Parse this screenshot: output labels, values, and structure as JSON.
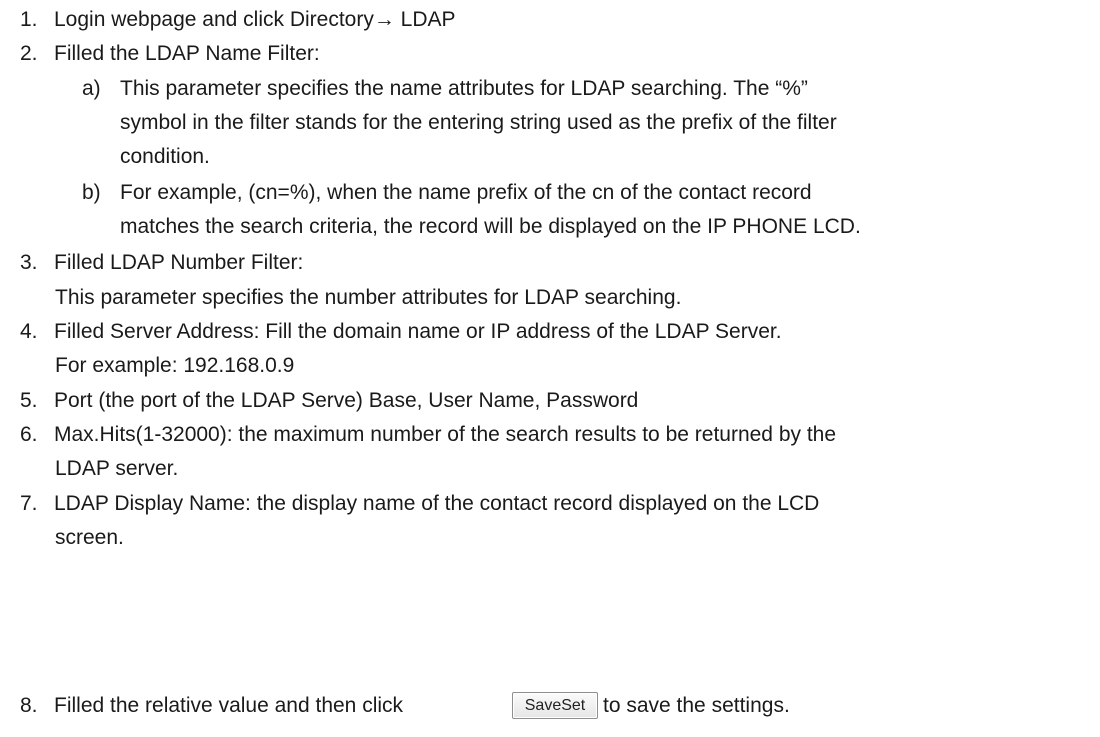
{
  "steps": [
    {
      "num": "1.",
      "text": "Login webpage and click Directory→ LDAP"
    },
    {
      "num": "2.",
      "text": "Filled the LDAP Name Filter:"
    },
    {
      "num": "3.",
      "text": "Filled LDAP Number Filter:"
    },
    {
      "num": "4.",
      "text": "Filled Server Address: Fill the domain name or IP address of the LDAP Server."
    },
    {
      "num": "5.",
      "text": "Port (the port of the LDAP Serve) Base, User Name, Password"
    },
    {
      "num": "6.",
      "text": "Max.Hits(1-32000): the maximum number of the search results to be returned by the"
    },
    {
      "num": "7.",
      "text": "LDAP Display Name: the display name of the contact record displayed on the LCD"
    },
    {
      "num": "8.",
      "text_before": "Filled the relative value and then click",
      "text_after": "to save the settings."
    }
  ],
  "substeps": [
    {
      "label": "a)",
      "lines": [
        "This parameter specifies the name attributes for LDAP searching. The “%”",
        "symbol in the filter stands for the entering string used as the prefix of the filter",
        "condition."
      ]
    },
    {
      "label": "b)",
      "lines": [
        "For example, (cn=%), when the name prefix of the cn of the contact record",
        "matches the search criteria, the record will be displayed on the IP PHONE LCD."
      ]
    }
  ],
  "continuations": {
    "step3": "This parameter specifies the number attributes for LDAP searching.",
    "step4": "For example: 192.168.0.9",
    "step6": "LDAP server.",
    "step7": "screen."
  },
  "button": {
    "label": "SaveSet"
  }
}
